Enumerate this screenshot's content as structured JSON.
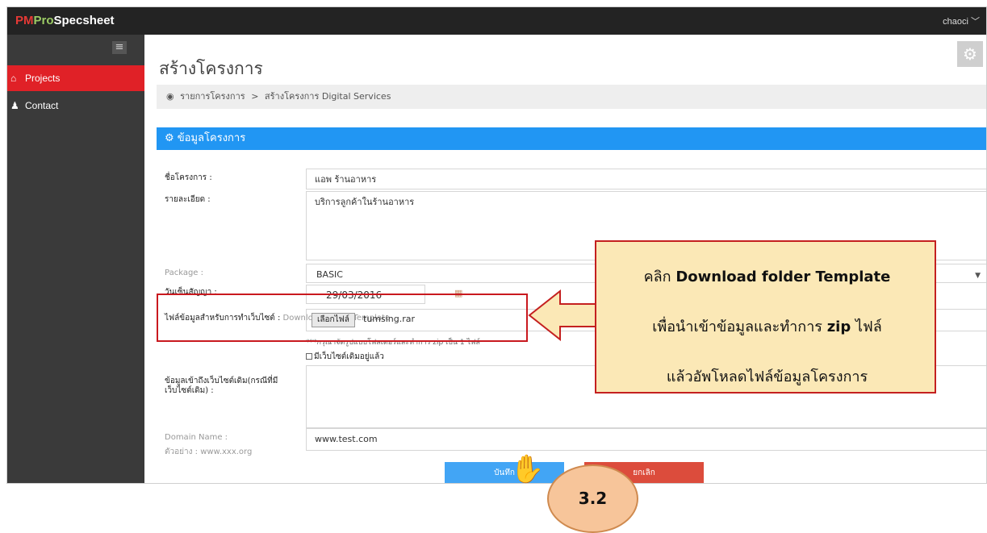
{
  "brand": {
    "pm": "PM",
    "pro": "Pro",
    "specsheet": "Specsheet"
  },
  "user": {
    "name": "chaoci",
    "caret": "﹀"
  },
  "sidebar": {
    "items": [
      {
        "label": "Projects",
        "icon": "home-icon",
        "active": true
      },
      {
        "label": "Contact",
        "icon": "user-icon",
        "active": false
      }
    ]
  },
  "page": {
    "title": "สร้างโครงการ"
  },
  "breadcrumb": {
    "home": "รายการโครงการ",
    "sep": ">",
    "current": "สร้างโครงการ Digital Services"
  },
  "panel": {
    "title": "ข้อมูลโครงการ"
  },
  "form": {
    "name_label": "ชื่อโครงการ :",
    "name_value": "แอพ ร้านอาหาร",
    "desc_label": "รายละเอียด :",
    "desc_value": "บริการลูกค้าในร้านอาหาร",
    "package_label": "Package :",
    "package_value": "BASIC",
    "date_label": "วันเซ็นสัญญา :",
    "date_value": "29/03/2016",
    "file_label": "ไฟล์ข้อมูลสำหรับการทำเว็บไซต์ :",
    "file_link": "Download Folder Template",
    "file_button": "เลือกไฟล์",
    "file_name": "tumsing.rar",
    "file_note": "***กรุณาจัดรูปแบบโฟลเดอร์และทำการ zip เป็น 1 ไฟล์",
    "existing_site_checkbox": "มีเว็บไซต์เดิมอยู่แล้ว",
    "access_label": "ข้อมูลเข้าถึงเว็บไซต์เดิม(กรณีที่มีเว็บไซต์เดิม) :",
    "domain_label": "Domain Name :",
    "domain_example": "ตัวอย่าง : www.xxx.org",
    "domain_value": "www.test.com",
    "save_button": "บันทึก",
    "cancel_button": "ยกเลิก"
  },
  "annotation": {
    "line1_prefix": "คลิก ",
    "line1_bold": "Download folder Template",
    "line2_prefix": "เพื่อนำเข้าข้อมูลและทำการ ",
    "line2_bold": "zip",
    "line2_suffix": " ไฟล์",
    "line3": "แล้วอัพโหลดไฟล์ข้อมูลโครงการ",
    "step": "3.2"
  },
  "colors": {
    "accent": "#2196f3",
    "active_nav": "#e02127",
    "cancel": "#dc4c3c",
    "callout_bg": "#fbe8b6"
  }
}
